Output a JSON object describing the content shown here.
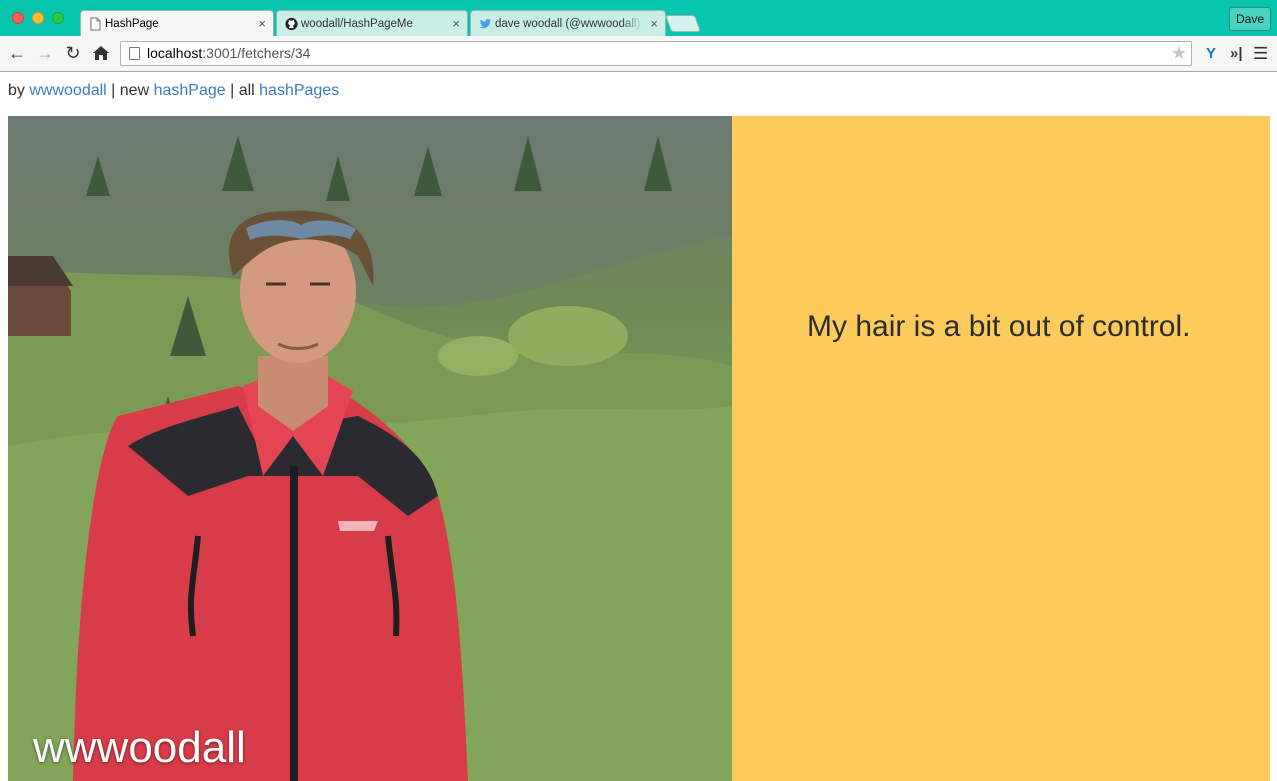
{
  "browser": {
    "tabs": [
      {
        "label": "HashPage",
        "icon": "page-icon",
        "active": true
      },
      {
        "label": "woodall/HashPageMe",
        "icon": "github-icon",
        "active": false
      },
      {
        "label": "dave woodall (@wwwoodall)",
        "icon": "twitter-icon",
        "active": false
      }
    ],
    "profile_label": "Dave",
    "url_host": "localhost",
    "url_rest": ":3001/fetchers/34"
  },
  "page": {
    "nav": {
      "by": "by",
      "author_link": "wwwoodall",
      "sep1": " | new ",
      "new_link": "hashPage",
      "sep2": " | all ",
      "all_link": "hashPages"
    },
    "photo_caption": "wwwoodall",
    "quote": "My hair is a bit out of control.",
    "quote_bg": "#fdcb5b"
  }
}
